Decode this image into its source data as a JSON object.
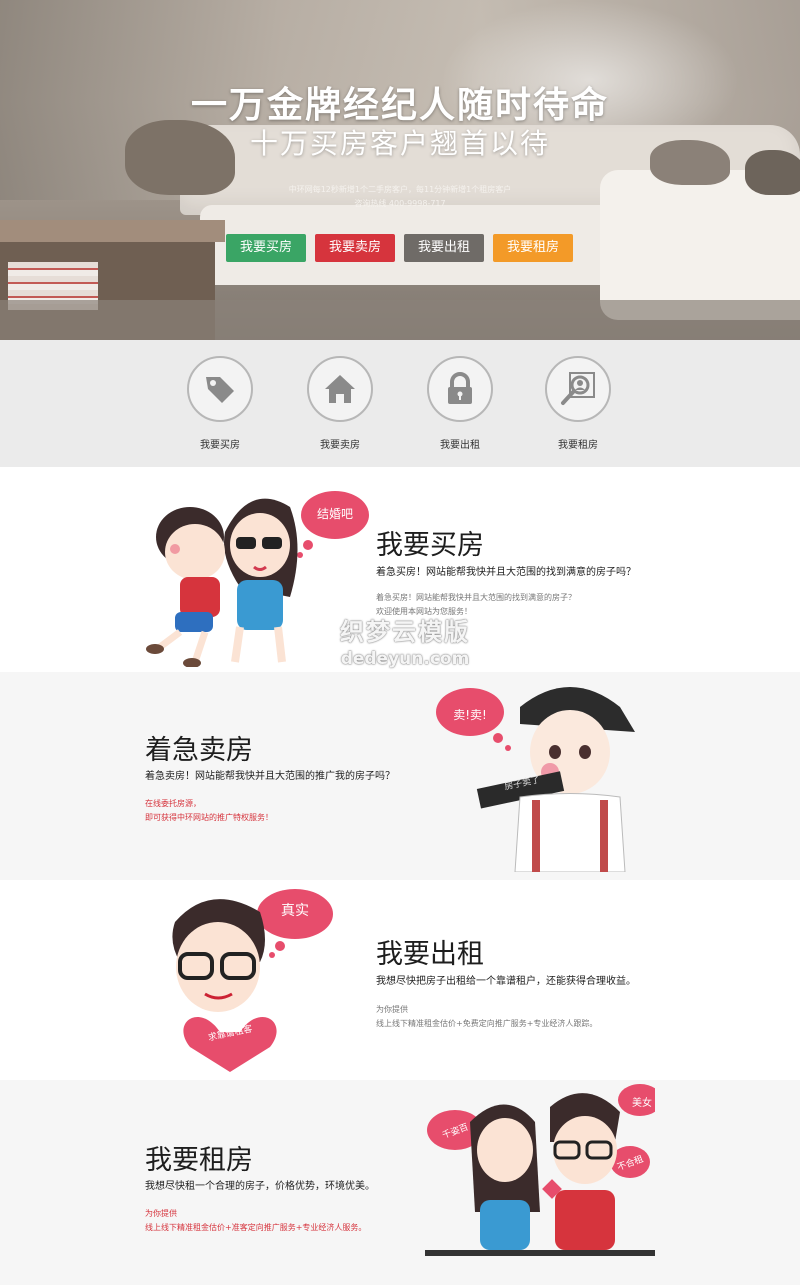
{
  "hero": {
    "title": "一万金牌经纪人随时待命",
    "subtitle": "十万买房客户翘首以待",
    "note": "中环网每12秒新增1个二手房客户，每11分钟新增1个租房客户",
    "hotline": "咨询热线  400-9998-717",
    "buttons": [
      {
        "label": "我要买房",
        "color": "#3aa565"
      },
      {
        "label": "我要卖房",
        "color": "#d6343d"
      },
      {
        "label": "我要出租",
        "color": "#6f6b67"
      },
      {
        "label": "我要租房",
        "color": "#f39a28"
      }
    ]
  },
  "services": [
    {
      "label": "我要买房",
      "icon": "tag-icon"
    },
    {
      "label": "我要卖房",
      "icon": "house-icon"
    },
    {
      "label": "我要出租",
      "icon": "lock-icon"
    },
    {
      "label": "我要租房",
      "icon": "search-person-icon"
    }
  ],
  "sections": {
    "buy": {
      "title": "我要买房",
      "lead": "着急买房！网站能帮我快并且大范围的找到满意的房子吗？",
      "line1": "着急买房！网站能帮我快并且大范围的找到满意的房子？",
      "line2": "欢迎使用本网站为您服务！",
      "bubble": "结婚吧"
    },
    "sell": {
      "title": "着急卖房",
      "lead": "着急卖房！网站能帮我快并且大范围的推广我的房子吗？",
      "line1": "在线委托房源，",
      "line2": "即可获得中环网站的推广特权服务！",
      "bubble": "卖!卖!",
      "sign": "房子卖了"
    },
    "rent_out": {
      "title": "我要出租",
      "lead": "我想尽快把房子出租给一个靠谱租户，还能获得合理收益。",
      "line1": "为你提供",
      "line2": "线上线下精准租金估价+免费定向推广服务+专业经济人跟踪。",
      "bubble": "真实",
      "heart": "求靠谱租客"
    },
    "rent": {
      "title": "我要租房",
      "lead": "我想尽快租一个合理的房子，价格优势，环境优美。",
      "line1": "为你提供",
      "line2": "线上线下精准租金估价+准客定向推广服务+专业经济人服务。",
      "bubble_left": "千姿百",
      "bubble_right": "美女",
      "bubble_right2": "不合租"
    }
  },
  "watermark": {
    "line1": "织梦云模版",
    "line2": "dedeyun.com"
  }
}
